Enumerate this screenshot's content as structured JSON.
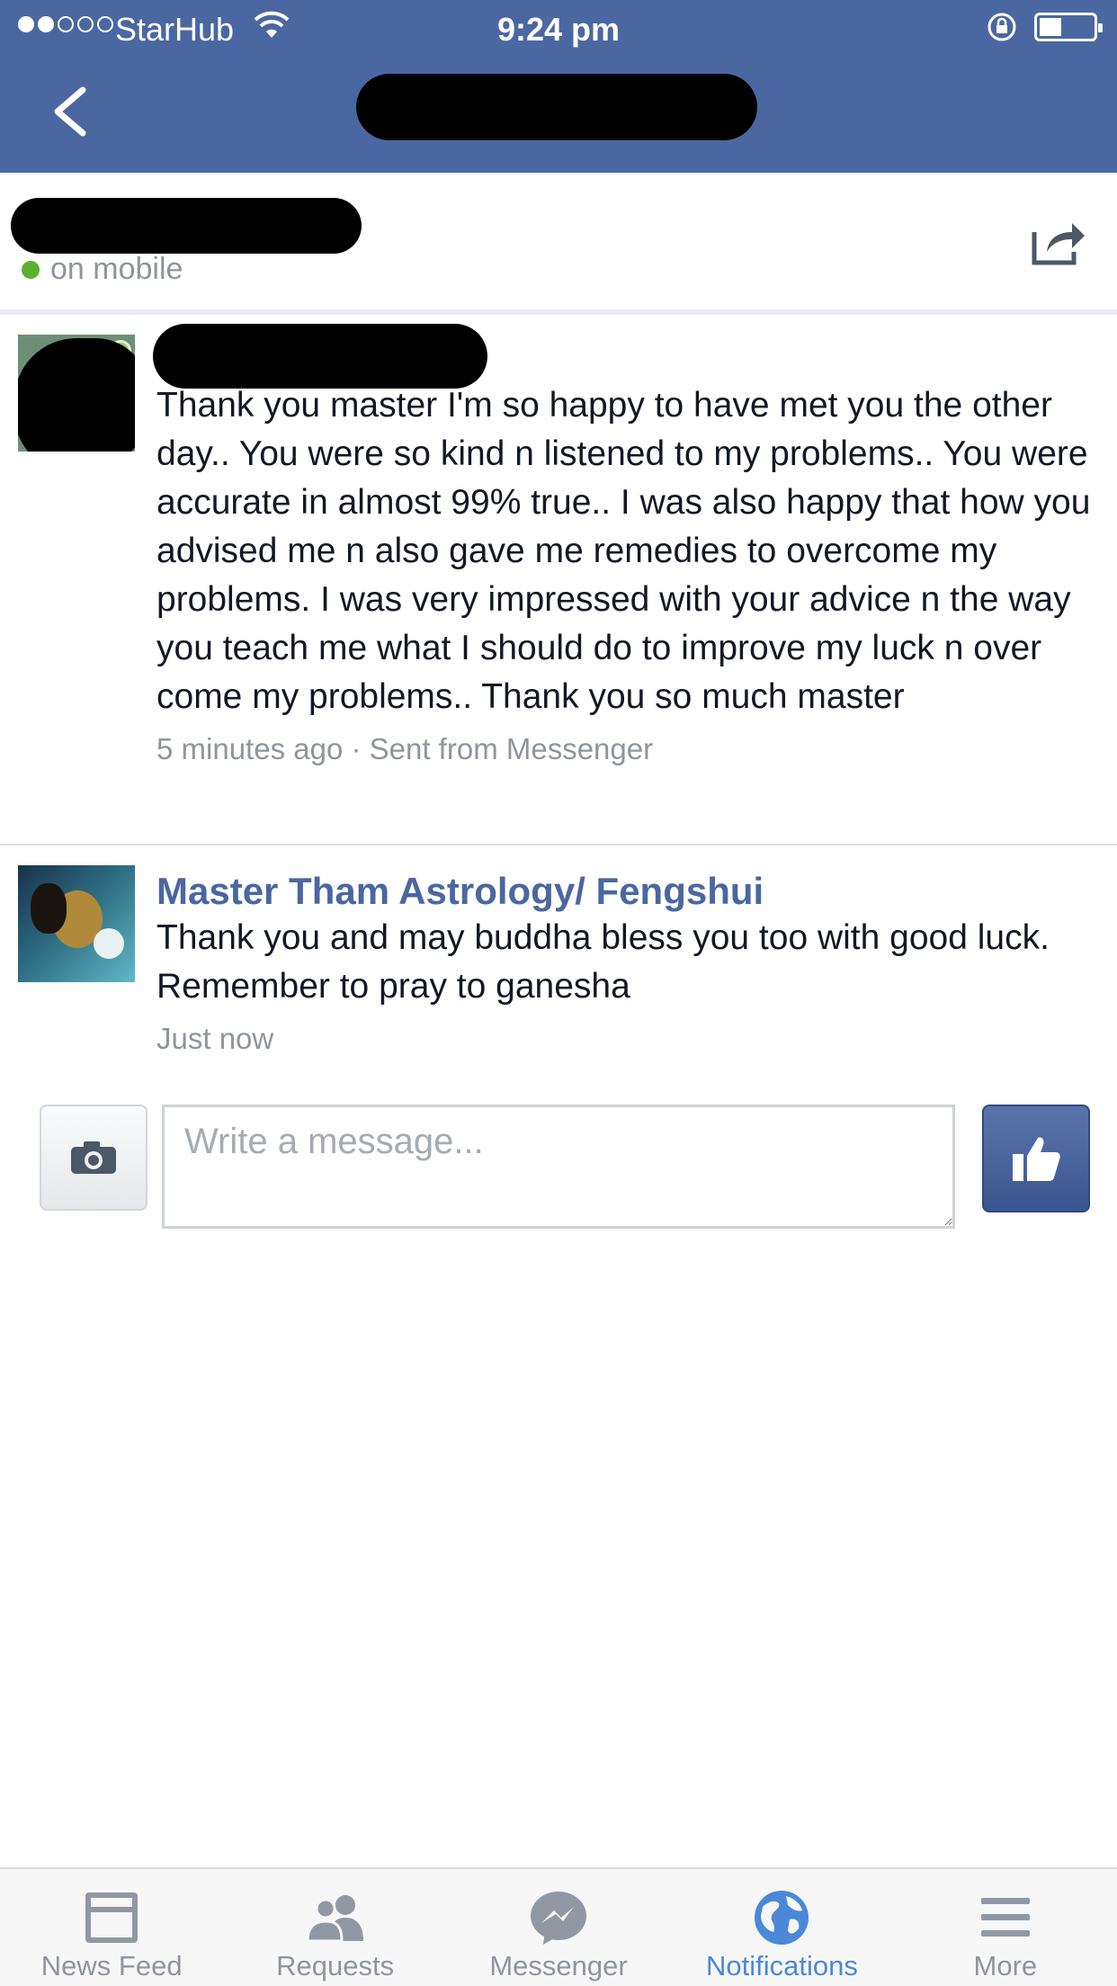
{
  "status_bar": {
    "carrier": "StarHub",
    "time": "9:24 pm"
  },
  "header": {
    "presence": "on mobile"
  },
  "messages": [
    {
      "sender": "",
      "text": "Thank you master I'm so happy to have met you the other day.. You were so kind n listened to my problems.. You were accurate in almost 99% true.. I was also happy that how you advised me n also gave me remedies to overcome my problems. I was very impressed with your advice n the way you teach me what I should do to improve my luck n over come my problems.. Thank you so much master",
      "meta": "5 minutes ago · Sent from Messenger"
    },
    {
      "sender": "Master Tham Astrology/ Fengshui",
      "text": "Thank you and may buddha bless you too with good luck. Remember to pray to ganesha",
      "meta": "Just now"
    }
  ],
  "composer": {
    "placeholder": "Write a message..."
  },
  "tabs": [
    {
      "label": "News Feed",
      "icon": "news-feed-icon",
      "active": false
    },
    {
      "label": "Requests",
      "icon": "friend-requests-icon",
      "active": false
    },
    {
      "label": "Messenger",
      "icon": "messenger-icon",
      "active": false
    },
    {
      "label": "Notifications",
      "icon": "globe-icon",
      "active": true
    },
    {
      "label": "More",
      "icon": "menu-icon",
      "active": false
    }
  ],
  "colors": {
    "brand": "#4b67a1",
    "active_tab": "#4b88d8",
    "online": "#5cb031"
  }
}
